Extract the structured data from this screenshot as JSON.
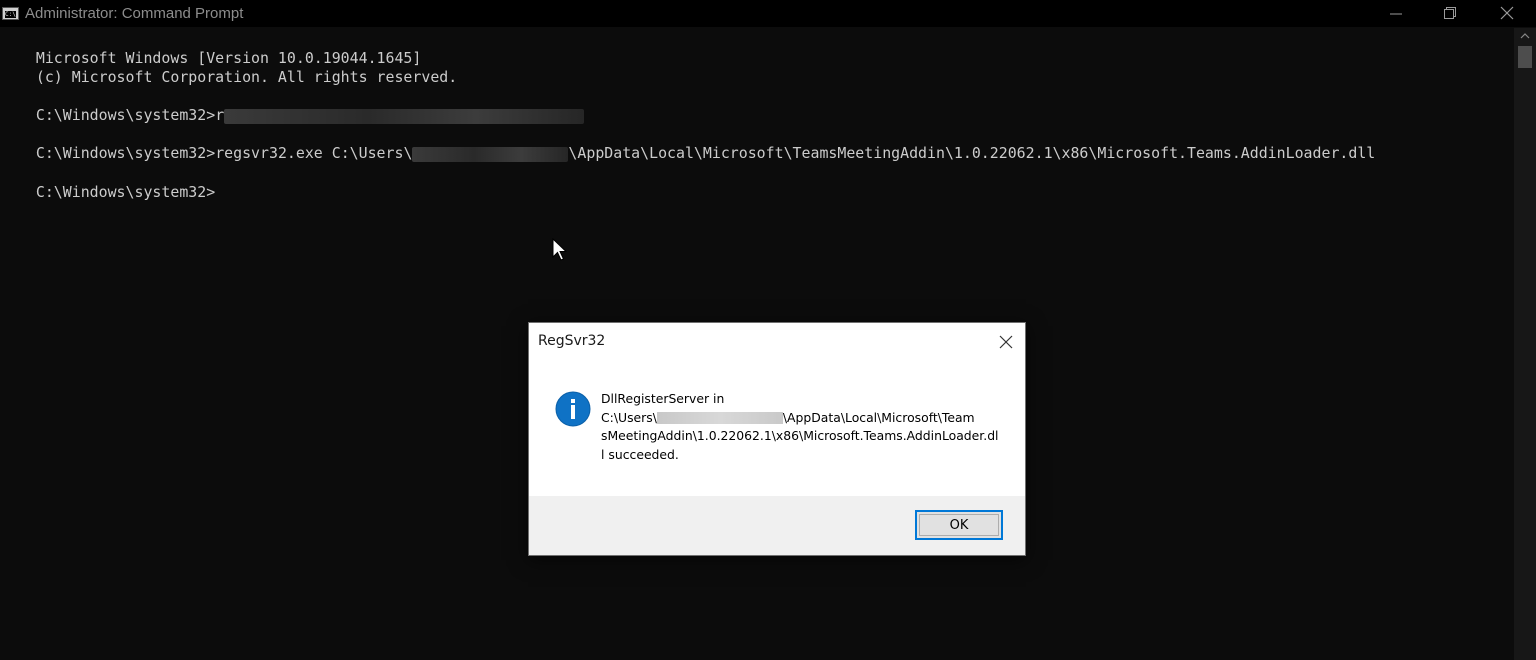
{
  "window": {
    "title": "Administrator: Command Prompt",
    "icon_label": "C:\\",
    "controls": [
      "minimize",
      "restore",
      "close"
    ]
  },
  "console": {
    "lines": [
      {
        "text": "Microsoft Windows [Version 10.0.19044.1645]"
      },
      {
        "text": "(c) Microsoft Corporation. All rights reserved."
      },
      {
        "prompt": "C:\\Windows\\system32>",
        "text": "r"
      },
      {
        "prompt": "C:\\Windows\\system32>",
        "text_before": "regsvr32.exe C:\\Users\\",
        "text_after": "\\AppData\\Local\\Microsoft\\TeamsMeetingAddin\\1.0.22062.1\\x86\\Microsoft.Teams.AddinLoader.dll"
      },
      {
        "prompt": "C:\\Windows\\system32>",
        "text": ""
      }
    ]
  },
  "dialog": {
    "title": "RegSvr32",
    "message_lines": [
      "DllRegisterServer in",
      "C:\\Users\\",
      "\\AppData\\Local\\Microsoft\\Team",
      "sMeetingAddin\\1.0.22062.1\\x86\\Microsoft.Teams.AddinLoader.dl",
      "l succeeded."
    ],
    "ok_label": "OK",
    "icon": "info-icon"
  },
  "colors": {
    "console_bg": "#0c0c0c",
    "console_text": "#cccccc",
    "accent": "#0078d7"
  }
}
